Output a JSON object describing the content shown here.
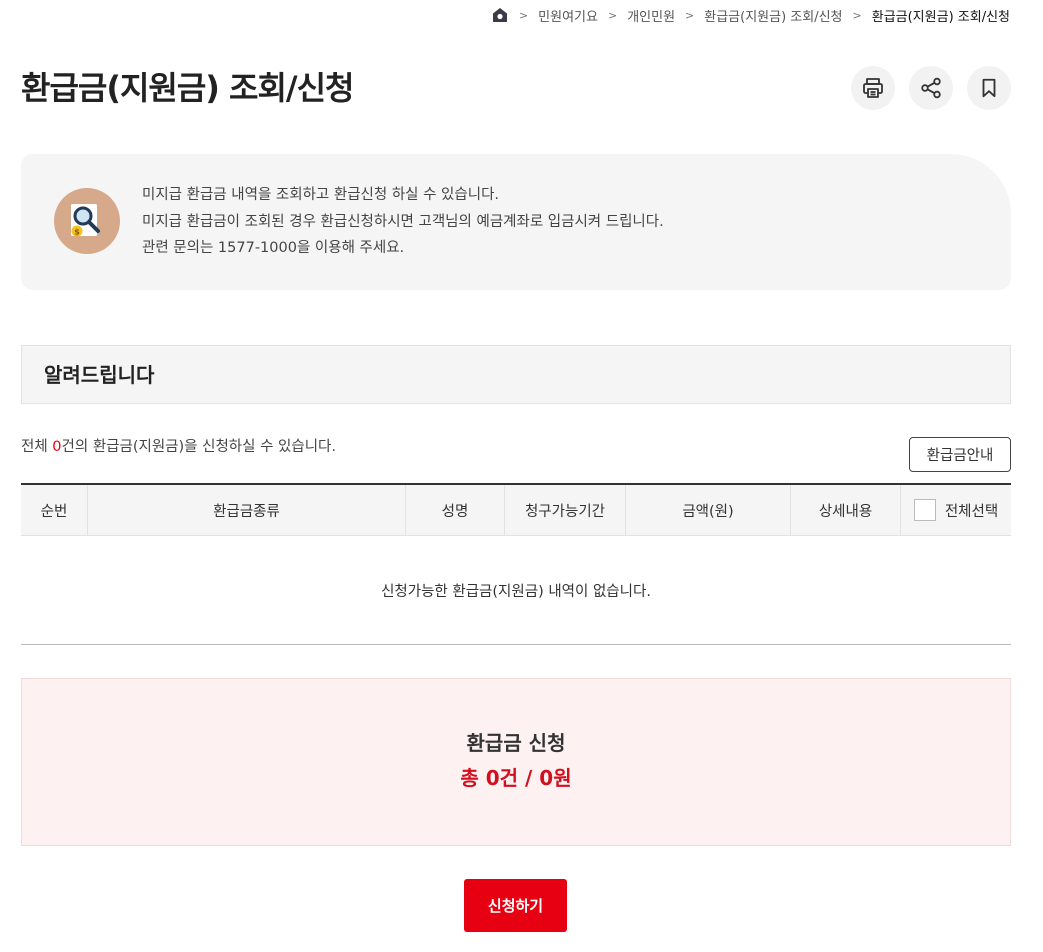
{
  "breadcrumb": {
    "items": [
      "민원여기요",
      "개인민원",
      "환급금(지원금) 조회/신청",
      "환급금(지원금) 조회/신청"
    ]
  },
  "header": {
    "title": "환급금(지원금) 조회/신청"
  },
  "tools": {
    "icons": [
      "print-icon",
      "share-icon",
      "bookmark-icon"
    ]
  },
  "info": {
    "lines": [
      "미지급 환급금 내역을 조회하고 환급신청 하실 수 있습니다.",
      "미지급 환급금이 조회된 경우 환급신청하시면 고객님의 예금계좌로 입금시켜 드립니다.",
      "관련 문의는 1577-1000을 이용해 주세요."
    ]
  },
  "notice": {
    "title": "알려드립니다"
  },
  "summary": {
    "prefix": "전체 ",
    "count": "0",
    "suffix": "건의 환급금(지원금)을 신청하실 수 있습니다."
  },
  "guide_button": "환급금안내",
  "table": {
    "headers": [
      "순번",
      "환급금종류",
      "성명",
      "청구가능기간",
      "금액(원)",
      "상세내용",
      "전체선택"
    ],
    "empty_message": "신청가능한 환급금(지원금) 내역이 없습니다."
  },
  "apply": {
    "title": "환급금 신청",
    "total": "총 0건 / 0원"
  },
  "submit_button": "신청하기",
  "colors": {
    "accent_red": "#e60012",
    "total_red": "#d20f1f",
    "panel_gray": "#f5f5f5",
    "apply_pink": "#fdf1f1",
    "icon_bg": "#d6a98a"
  }
}
